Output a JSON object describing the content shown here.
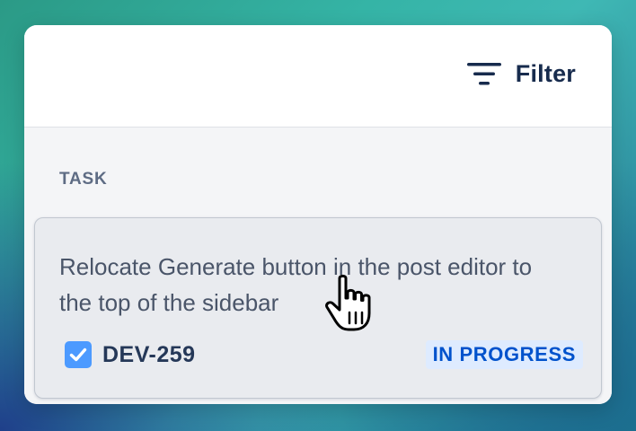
{
  "toolbar": {
    "filter_label": "Filter",
    "filter_icon": "filter-icon"
  },
  "column": {
    "header": "TASK"
  },
  "card": {
    "title": "Relocate Generate button in the post editor to the top of the sidebar",
    "issue_type_icon": "checkbox-icon",
    "issue_key": "DEV-259",
    "status": "IN PROGRESS"
  },
  "cursor": {
    "icon": "hand-pointer-icon"
  },
  "colors": {
    "text_primary": "#172b4d",
    "text_muted": "#5e6c84",
    "status_text": "#0052cc",
    "status_bg": "#deebff",
    "task_icon": "#4c9aff"
  }
}
